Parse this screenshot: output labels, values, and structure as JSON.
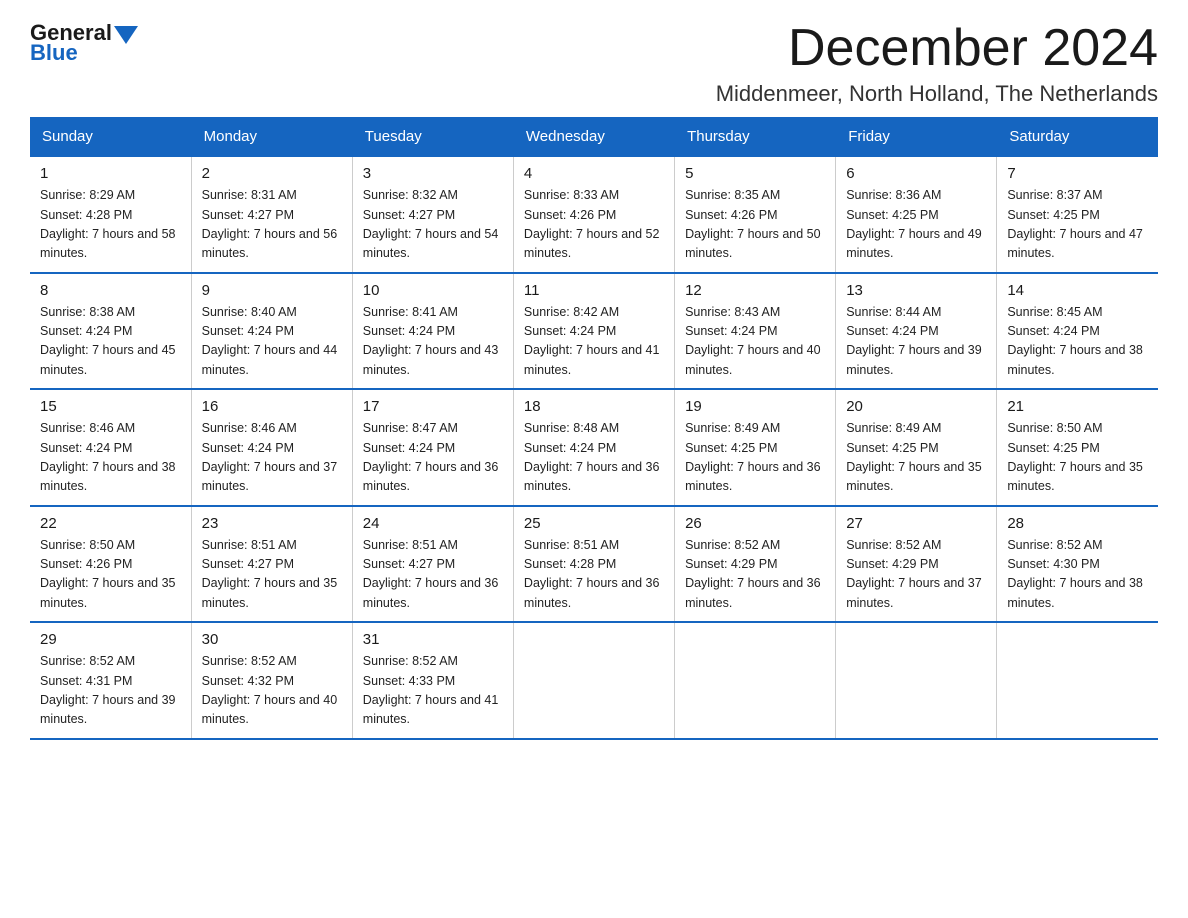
{
  "header": {
    "logo_general": "General",
    "logo_blue": "Blue",
    "month_title": "December 2024",
    "location": "Middenmeer, North Holland, The Netherlands"
  },
  "weekdays": [
    "Sunday",
    "Monday",
    "Tuesday",
    "Wednesday",
    "Thursday",
    "Friday",
    "Saturday"
  ],
  "weeks": [
    [
      {
        "day": "1",
        "sunrise": "8:29 AM",
        "sunset": "4:28 PM",
        "daylight": "7 hours and 58 minutes."
      },
      {
        "day": "2",
        "sunrise": "8:31 AM",
        "sunset": "4:27 PM",
        "daylight": "7 hours and 56 minutes."
      },
      {
        "day": "3",
        "sunrise": "8:32 AM",
        "sunset": "4:27 PM",
        "daylight": "7 hours and 54 minutes."
      },
      {
        "day": "4",
        "sunrise": "8:33 AM",
        "sunset": "4:26 PM",
        "daylight": "7 hours and 52 minutes."
      },
      {
        "day": "5",
        "sunrise": "8:35 AM",
        "sunset": "4:26 PM",
        "daylight": "7 hours and 50 minutes."
      },
      {
        "day": "6",
        "sunrise": "8:36 AM",
        "sunset": "4:25 PM",
        "daylight": "7 hours and 49 minutes."
      },
      {
        "day": "7",
        "sunrise": "8:37 AM",
        "sunset": "4:25 PM",
        "daylight": "7 hours and 47 minutes."
      }
    ],
    [
      {
        "day": "8",
        "sunrise": "8:38 AM",
        "sunset": "4:24 PM",
        "daylight": "7 hours and 45 minutes."
      },
      {
        "day": "9",
        "sunrise": "8:40 AM",
        "sunset": "4:24 PM",
        "daylight": "7 hours and 44 minutes."
      },
      {
        "day": "10",
        "sunrise": "8:41 AM",
        "sunset": "4:24 PM",
        "daylight": "7 hours and 43 minutes."
      },
      {
        "day": "11",
        "sunrise": "8:42 AM",
        "sunset": "4:24 PM",
        "daylight": "7 hours and 41 minutes."
      },
      {
        "day": "12",
        "sunrise": "8:43 AM",
        "sunset": "4:24 PM",
        "daylight": "7 hours and 40 minutes."
      },
      {
        "day": "13",
        "sunrise": "8:44 AM",
        "sunset": "4:24 PM",
        "daylight": "7 hours and 39 minutes."
      },
      {
        "day": "14",
        "sunrise": "8:45 AM",
        "sunset": "4:24 PM",
        "daylight": "7 hours and 38 minutes."
      }
    ],
    [
      {
        "day": "15",
        "sunrise": "8:46 AM",
        "sunset": "4:24 PM",
        "daylight": "7 hours and 38 minutes."
      },
      {
        "day": "16",
        "sunrise": "8:46 AM",
        "sunset": "4:24 PM",
        "daylight": "7 hours and 37 minutes."
      },
      {
        "day": "17",
        "sunrise": "8:47 AM",
        "sunset": "4:24 PM",
        "daylight": "7 hours and 36 minutes."
      },
      {
        "day": "18",
        "sunrise": "8:48 AM",
        "sunset": "4:24 PM",
        "daylight": "7 hours and 36 minutes."
      },
      {
        "day": "19",
        "sunrise": "8:49 AM",
        "sunset": "4:25 PM",
        "daylight": "7 hours and 36 minutes."
      },
      {
        "day": "20",
        "sunrise": "8:49 AM",
        "sunset": "4:25 PM",
        "daylight": "7 hours and 35 minutes."
      },
      {
        "day": "21",
        "sunrise": "8:50 AM",
        "sunset": "4:25 PM",
        "daylight": "7 hours and 35 minutes."
      }
    ],
    [
      {
        "day": "22",
        "sunrise": "8:50 AM",
        "sunset": "4:26 PM",
        "daylight": "7 hours and 35 minutes."
      },
      {
        "day": "23",
        "sunrise": "8:51 AM",
        "sunset": "4:27 PM",
        "daylight": "7 hours and 35 minutes."
      },
      {
        "day": "24",
        "sunrise": "8:51 AM",
        "sunset": "4:27 PM",
        "daylight": "7 hours and 36 minutes."
      },
      {
        "day": "25",
        "sunrise": "8:51 AM",
        "sunset": "4:28 PM",
        "daylight": "7 hours and 36 minutes."
      },
      {
        "day": "26",
        "sunrise": "8:52 AM",
        "sunset": "4:29 PM",
        "daylight": "7 hours and 36 minutes."
      },
      {
        "day": "27",
        "sunrise": "8:52 AM",
        "sunset": "4:29 PM",
        "daylight": "7 hours and 37 minutes."
      },
      {
        "day": "28",
        "sunrise": "8:52 AM",
        "sunset": "4:30 PM",
        "daylight": "7 hours and 38 minutes."
      }
    ],
    [
      {
        "day": "29",
        "sunrise": "8:52 AM",
        "sunset": "4:31 PM",
        "daylight": "7 hours and 39 minutes."
      },
      {
        "day": "30",
        "sunrise": "8:52 AM",
        "sunset": "4:32 PM",
        "daylight": "7 hours and 40 minutes."
      },
      {
        "day": "31",
        "sunrise": "8:52 AM",
        "sunset": "4:33 PM",
        "daylight": "7 hours and 41 minutes."
      },
      null,
      null,
      null,
      null
    ]
  ]
}
